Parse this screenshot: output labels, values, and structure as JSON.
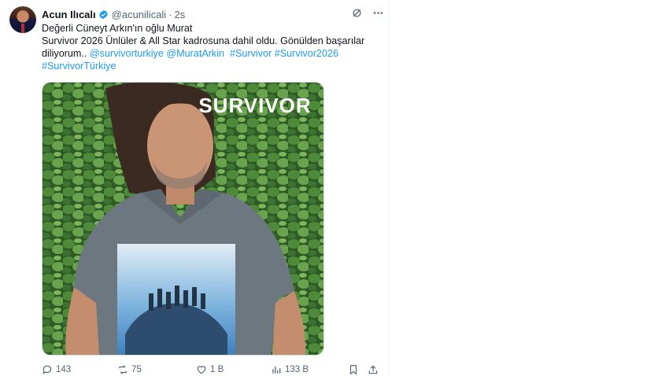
{
  "author": {
    "name": "Acun Ilıcalı",
    "handle": "@acunilicali",
    "separator": "·",
    "time": "2s"
  },
  "tweet": {
    "line1": "Değerli Cüneyt Arkın'ın oğlu Murat",
    "line2": "Survivor 2026 Ünlüler & All Star kadrosuna dahil oldu. Gönülden başarılar",
    "line3_text": "diliyorum.. ",
    "line3_links": [
      "@survivorturkiye",
      "@MuratArkin",
      "#Survivor",
      "#Survivor2026"
    ],
    "line4_links": [
      "#SurvivorTürkiye"
    ]
  },
  "media": {
    "watermark": "SURVIVOR"
  },
  "metrics": {
    "replies": "143",
    "reposts": "75",
    "likes": "1 B",
    "views": "133 B"
  },
  "colors": {
    "link": "#1d9bf0",
    "muted": "#536471",
    "verified": "#1d9bf0"
  },
  "icons": [
    "grok-icon",
    "more-icon",
    "reply-icon",
    "repost-icon",
    "like-icon",
    "views-icon",
    "bookmark-icon",
    "share-icon"
  ]
}
